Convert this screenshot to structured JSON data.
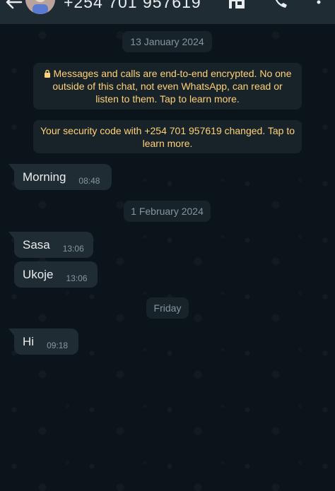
{
  "header": {
    "contact_name": "+254 701 957619",
    "icons": [
      "back-arrow-icon",
      "store-icon",
      "call-icon",
      "more-vert-icon"
    ]
  },
  "chat": {
    "date_chip_1": "13 January 2024",
    "encryption_notice": "Messages and calls are end-to-end encrypted. No one outside of this chat, not even WhatsApp, can read or listen to them. Tap to learn more.",
    "security_notice": "Your security code with +254 701 957619 changed. Tap to learn more.",
    "messages": [
      {
        "text": "Morning",
        "time": "08:48"
      },
      {
        "text": "Sasa",
        "time": "13:06"
      },
      {
        "text": "Ukoje",
        "time": "13:06"
      },
      {
        "text": "Hi",
        "time": "09:18"
      }
    ],
    "date_chip_2": "1 February 2024",
    "date_chip_3": "Friday"
  },
  "colors": {
    "background": "#0b141a",
    "header": "#1f2c34",
    "bubble_incoming": "#202c33",
    "system_text": "#ffd279",
    "muted_text": "#8696a0"
  }
}
